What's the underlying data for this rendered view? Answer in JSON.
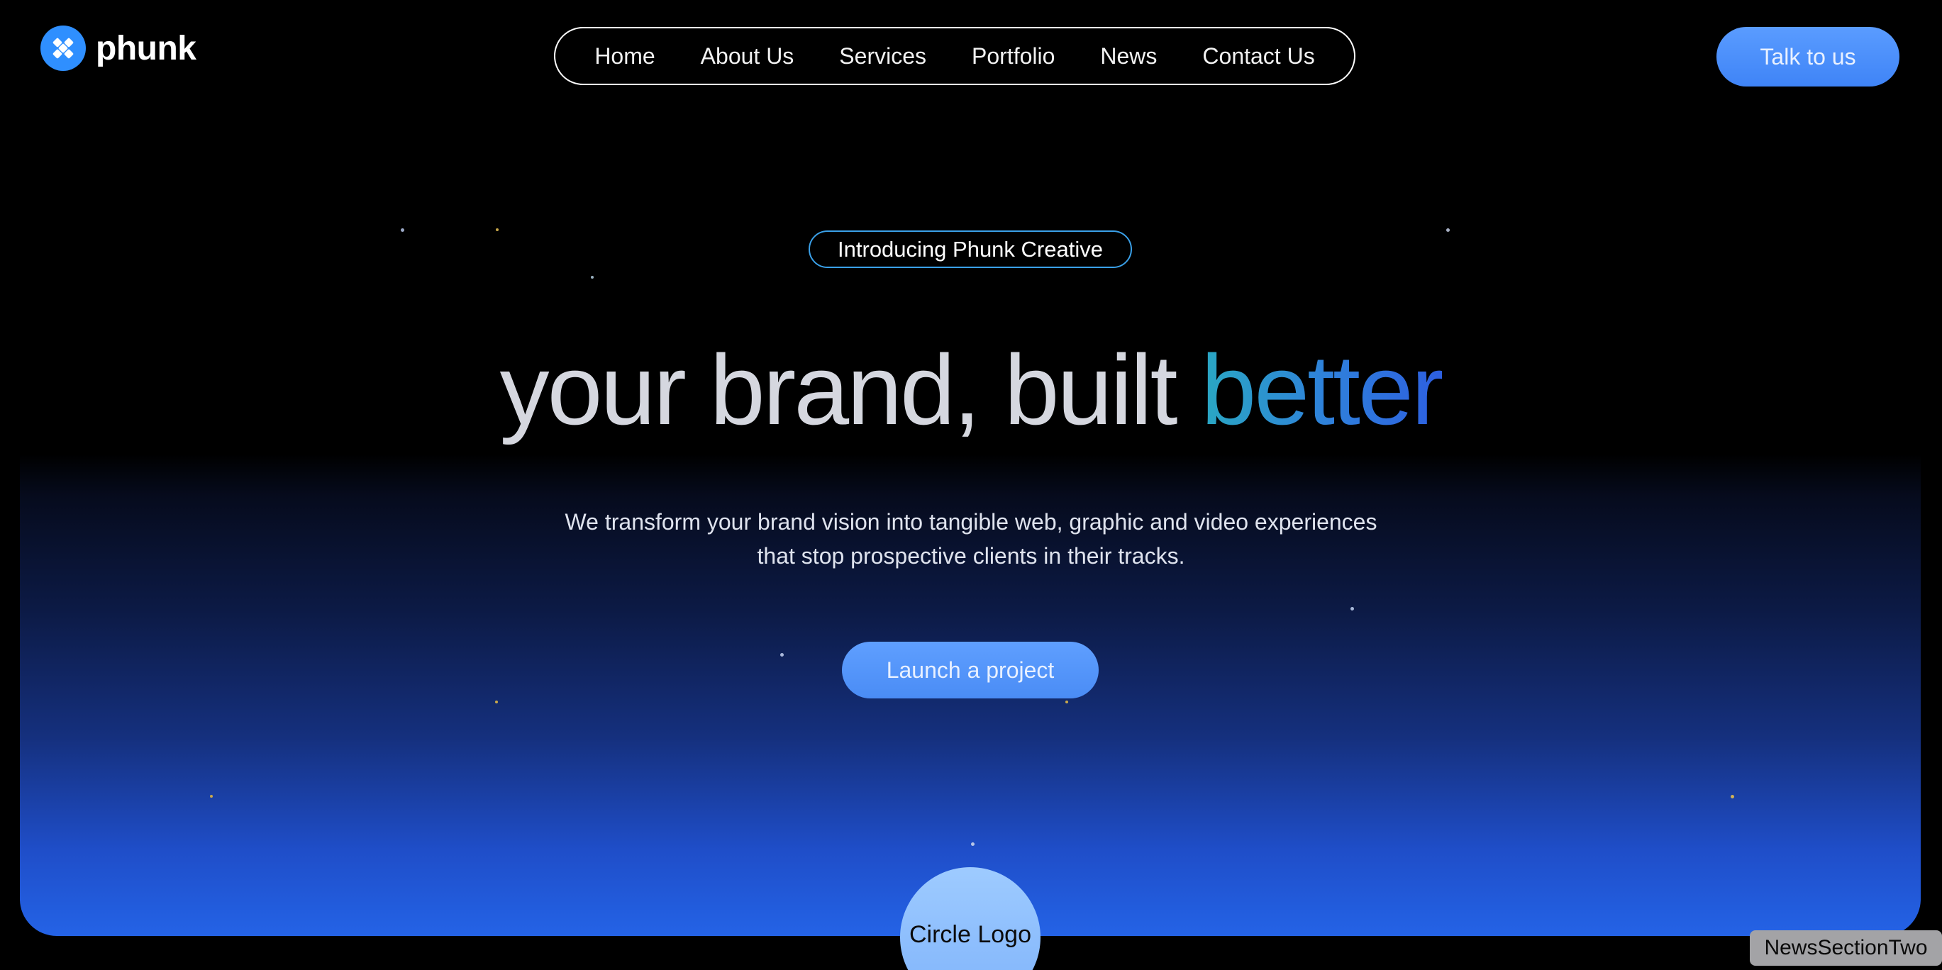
{
  "brand": {
    "name": "phunk",
    "logo_color": "#2f8fff",
    "logo_icon": "brand-mark-icon"
  },
  "nav": {
    "items": [
      {
        "label": "Home"
      },
      {
        "label": "About Us"
      },
      {
        "label": "Services"
      },
      {
        "label": "Portfolio"
      },
      {
        "label": "News"
      },
      {
        "label": "Contact Us"
      }
    ]
  },
  "header": {
    "cta_label": "Talk to us"
  },
  "hero": {
    "badge": "Introducing Phunk Creative",
    "headline_main": "your brand, built ",
    "headline_accent": "better",
    "subtitle_line1": "We transform your brand vision into tangible web, graphic and video experiences",
    "subtitle_line2": "that stop prospective clients in their tracks.",
    "cta_label": "Launch a project",
    "circle_logo_label": "Circle Logo"
  },
  "section_tag": "NewsSectionTwo",
  "colors": {
    "background": "#000000",
    "accent_blue": "#4a8cf5",
    "gradient_bottom": "#2463e6",
    "accent_teal": "#2aa7c2"
  }
}
